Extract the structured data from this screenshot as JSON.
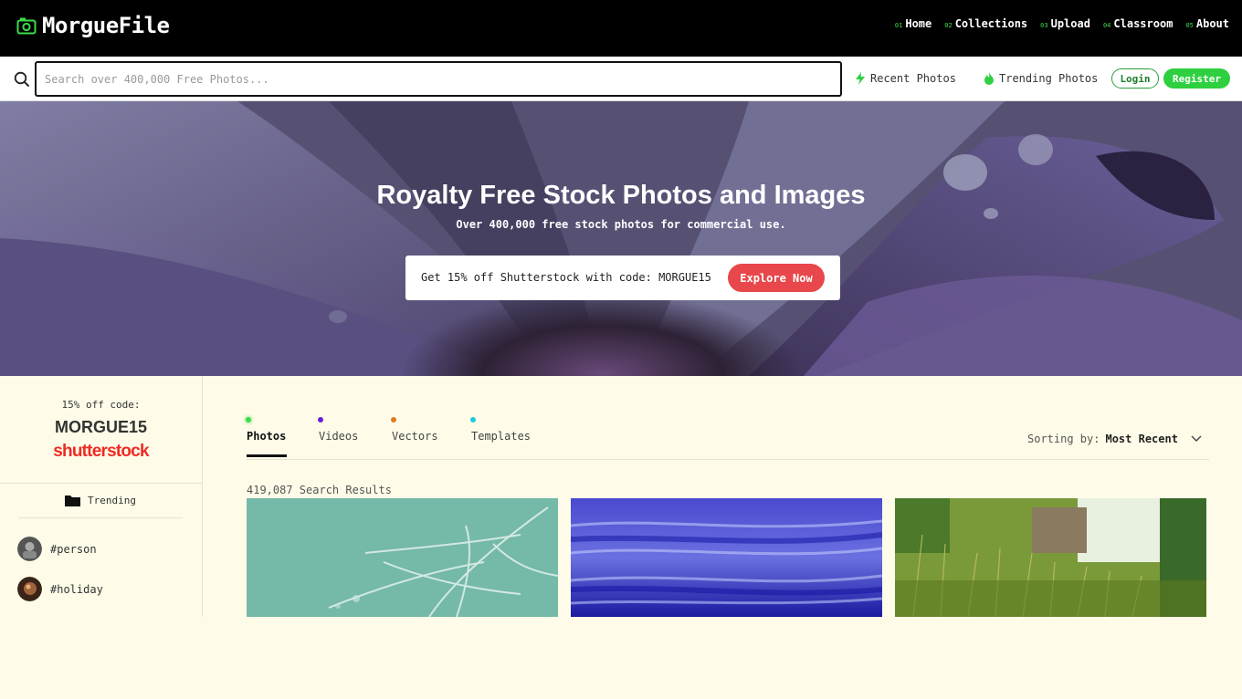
{
  "brand": {
    "name": "MorgueFile"
  },
  "nav": [
    {
      "num": "01",
      "label": "Home"
    },
    {
      "num": "02",
      "label": "Collections"
    },
    {
      "num": "03",
      "label": "Upload"
    },
    {
      "num": "04",
      "label": "Classroom"
    },
    {
      "num": "05",
      "label": "About"
    }
  ],
  "search": {
    "placeholder": "Search over 400,000 Free Photos...",
    "value": ""
  },
  "quick_links": {
    "recent": "Recent Photos",
    "trending": "Trending Photos"
  },
  "auth": {
    "login": "Login",
    "register": "Register"
  },
  "hero": {
    "title": "Royalty Free Stock Photos and Images",
    "subtitle": "Over 400,000 free stock photos for commercial use.",
    "promo_text": "Get 15% off Shutterstock with code: MORGUE15",
    "promo_button": "Explore Now"
  },
  "sidebar": {
    "promo_label": "15% off code:",
    "promo_code": "MORGUE15",
    "promo_brand": "shutterstock",
    "trending_label": "Trending",
    "tags": [
      "#person",
      "#holiday"
    ]
  },
  "tabs": [
    {
      "label": "Photos",
      "color": "#3ddc4a",
      "active": true
    },
    {
      "label": "Videos",
      "color": "#6a1fd0",
      "active": false
    },
    {
      "label": "Vectors",
      "color": "#e07a1f",
      "active": false
    },
    {
      "label": "Templates",
      "color": "#1fc8e0",
      "active": false
    }
  ],
  "sorting": {
    "label": "Sorting by:",
    "value": "Most Recent"
  },
  "results": {
    "count_text": "419,087 Search Results"
  },
  "colors": {
    "accent_green": "#2ed03f",
    "promo_red": "#e8474b",
    "page_bg": "#fefce8"
  },
  "icons": [
    "camera-icon",
    "search-icon",
    "bolt-icon",
    "flame-icon",
    "folder-icon",
    "chevron-down-icon"
  ]
}
